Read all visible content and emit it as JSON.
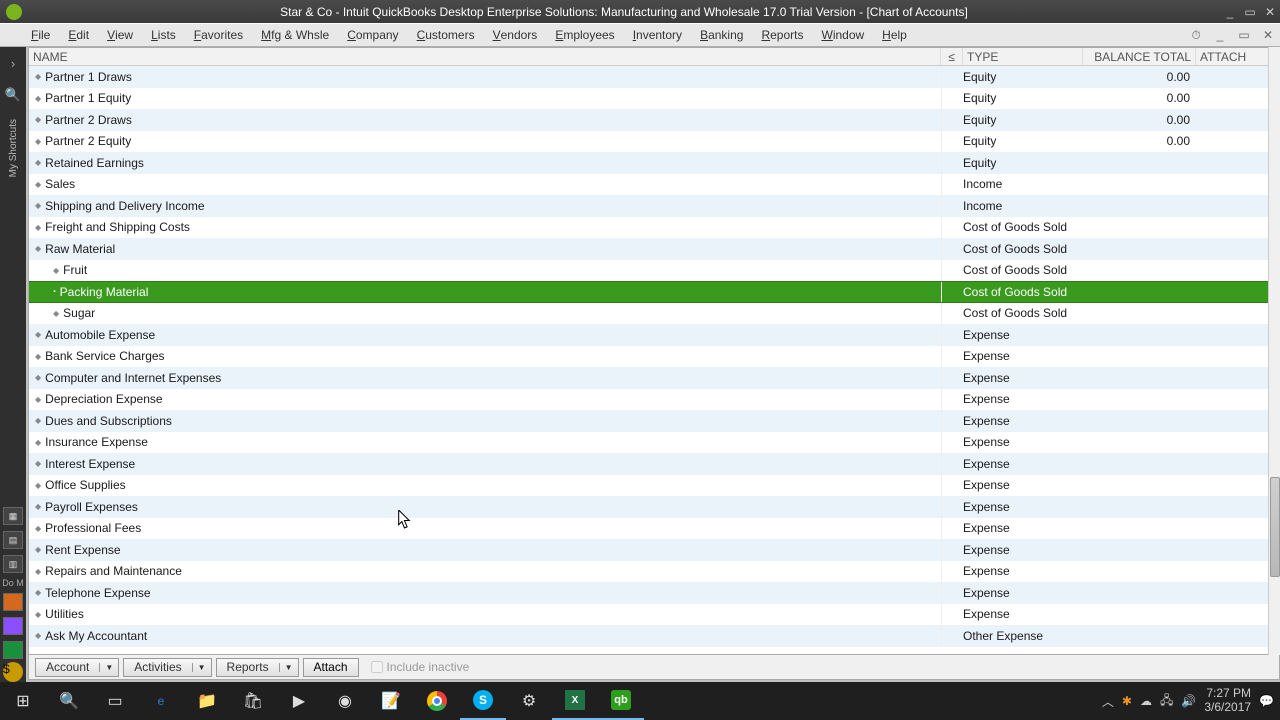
{
  "titlebar": {
    "title": "Star & Co  - Intuit QuickBooks Desktop Enterprise Solutions: Manufacturing and Wholesale 17.0 Trial Version - [Chart of Accounts]"
  },
  "menu": [
    "File",
    "Edit",
    "View",
    "Lists",
    "Favorites",
    "Mfg & Whsle",
    "Company",
    "Customers",
    "Vendors",
    "Employees",
    "Inventory",
    "Banking",
    "Reports",
    "Window",
    "Help"
  ],
  "columns": {
    "name": "NAME",
    "s": "≤",
    "type": "TYPE",
    "balance": "BALANCE TOTAL",
    "attach": "ATTACH"
  },
  "leftrail": {
    "shortcuts_label": "My Shortcuts",
    "do_more_label": "Do M"
  },
  "accounts": [
    {
      "name": "Partner 1 Draws",
      "type": "Equity",
      "balance": "0.00",
      "indent": 0
    },
    {
      "name": "Partner 1 Equity",
      "type": "Equity",
      "balance": "0.00",
      "indent": 0
    },
    {
      "name": "Partner 2 Draws",
      "type": "Equity",
      "balance": "0.00",
      "indent": 0
    },
    {
      "name": "Partner 2 Equity",
      "type": "Equity",
      "balance": "0.00",
      "indent": 0
    },
    {
      "name": "Retained Earnings",
      "type": "Equity",
      "balance": "",
      "indent": 0
    },
    {
      "name": "Sales",
      "type": "Income",
      "balance": "",
      "indent": 0
    },
    {
      "name": "Shipping and Delivery Income",
      "type": "Income",
      "balance": "",
      "indent": 0
    },
    {
      "name": "Freight and Shipping Costs",
      "type": "Cost of Goods Sold",
      "balance": "",
      "indent": 0
    },
    {
      "name": "Raw Material",
      "type": "Cost of Goods Sold",
      "balance": "",
      "indent": 0
    },
    {
      "name": "Fruit",
      "type": "Cost of Goods Sold",
      "balance": "",
      "indent": 1
    },
    {
      "name": "Packing Material",
      "type": "Cost of Goods Sold",
      "balance": "",
      "indent": 1,
      "selected": true,
      "minus": true
    },
    {
      "name": "Sugar",
      "type": "Cost of Goods Sold",
      "balance": "",
      "indent": 1
    },
    {
      "name": "Automobile Expense",
      "type": "Expense",
      "balance": "",
      "indent": 0
    },
    {
      "name": "Bank Service Charges",
      "type": "Expense",
      "balance": "",
      "indent": 0
    },
    {
      "name": "Computer and Internet Expenses",
      "type": "Expense",
      "balance": "",
      "indent": 0
    },
    {
      "name": "Depreciation Expense",
      "type": "Expense",
      "balance": "",
      "indent": 0
    },
    {
      "name": "Dues and Subscriptions",
      "type": "Expense",
      "balance": "",
      "indent": 0
    },
    {
      "name": "Insurance Expense",
      "type": "Expense",
      "balance": "",
      "indent": 0
    },
    {
      "name": "Interest Expense",
      "type": "Expense",
      "balance": "",
      "indent": 0
    },
    {
      "name": "Office Supplies",
      "type": "Expense",
      "balance": "",
      "indent": 0
    },
    {
      "name": "Payroll Expenses",
      "type": "Expense",
      "balance": "",
      "indent": 0
    },
    {
      "name": "Professional Fees",
      "type": "Expense",
      "balance": "",
      "indent": 0
    },
    {
      "name": "Rent Expense",
      "type": "Expense",
      "balance": "",
      "indent": 0
    },
    {
      "name": "Repairs and Maintenance",
      "type": "Expense",
      "balance": "",
      "indent": 0
    },
    {
      "name": "Telephone Expense",
      "type": "Expense",
      "balance": "",
      "indent": 0
    },
    {
      "name": "Utilities",
      "type": "Expense",
      "balance": "",
      "indent": 0
    },
    {
      "name": "Ask My Accountant",
      "type": "Other Expense",
      "balance": "",
      "indent": 0
    }
  ],
  "bottom": {
    "account": "Account",
    "activities": "Activities",
    "reports": "Reports",
    "attach": "Attach",
    "include_inactive": "Include inactive"
  },
  "taskbar": {
    "time": "7:27 PM",
    "date": "3/6/2017"
  }
}
